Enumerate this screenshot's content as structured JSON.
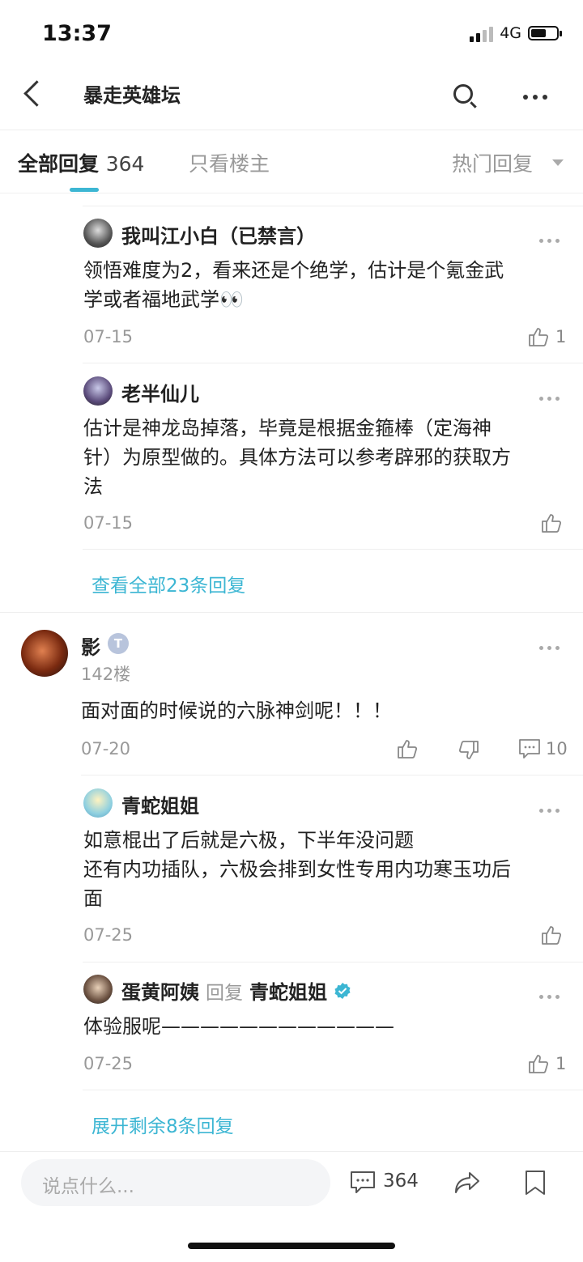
{
  "status": {
    "time": "13:37",
    "network": "4G"
  },
  "header": {
    "title": "暴走英雄坛"
  },
  "tabs": {
    "all_label": "全部回复",
    "all_count": "364",
    "op_only": "只看楼主",
    "sort": "热门回复"
  },
  "replies_top": [
    {
      "user": "我叫江小白（已禁言）",
      "text_line1": "领悟难度为2，看来还是个绝学，估计是个氪金武",
      "text_line2": "学或者福地武学👀",
      "date": "07-15",
      "likes": "1"
    },
    {
      "user": "老半仙儿",
      "text_line1": "估计是神龙岛掉落，毕竟是根据金箍棒（定海神",
      "text_line2": "针）为原型做的。具体方法可以参考辟邪的获取方",
      "text_line3": "法",
      "date": "07-15"
    }
  ],
  "view_all": "查看全部23条回复",
  "post": {
    "user": "影",
    "level": "T",
    "floor": "142楼",
    "text": "面对面的时候说的六脉神剑呢！！！",
    "date": "07-20",
    "comments": "10"
  },
  "replies_bottom": [
    {
      "user": "青蛇姐姐",
      "text_line1": "如意棍出了后就是六极，下半年没问题",
      "text_line2": "还有内功插队，六极会排到女性专用内功寒玉功后",
      "text_line3": "面",
      "date": "07-25"
    },
    {
      "user": "蛋黄阿姨",
      "reply_label": "回复",
      "reply_to": "青蛇姐姐",
      "text": "体验服呢————————————",
      "date": "07-25",
      "likes": "1"
    }
  ],
  "expand": "展开剩余8条回复",
  "bottom": {
    "placeholder": "说点什么...",
    "comment_count": "364"
  },
  "colors": {
    "accent": "#3cb6d3"
  }
}
